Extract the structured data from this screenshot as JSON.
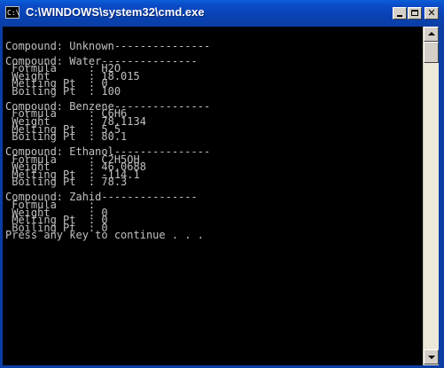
{
  "window": {
    "title": "C:\\WINDOWS\\system32\\cmd.exe",
    "icon": "cmd-icon",
    "icon_text": "C:\\"
  },
  "console": {
    "lines": [
      "",
      "Compound: Unknown---------------",
      "",
      "Compound: Water---------------",
      " Formula     : H2O",
      " Weight      : 18.015",
      " Melting Pt  : 0",
      " Boiling Pt  : 100",
      "",
      "Compound: Benzene---------------",
      " Formula     : C6H6",
      " Weight      : 78.1134",
      " Melting Pt  : 5.5",
      " Boiling Pt  : 80.1",
      "",
      "Compound: Ethanol---------------",
      " Formula     : C2H5OH",
      " Weight      : 46.0688",
      " Melting Pt  : -114.1",
      " Boiling Pt  : 78.3",
      "",
      "Compound: Zahid---------------",
      " Formula     :",
      " Weight      : 0",
      " Melting Pt  : 0",
      " Boiling Pt  : 0",
      "Press any key to continue . . ."
    ]
  }
}
